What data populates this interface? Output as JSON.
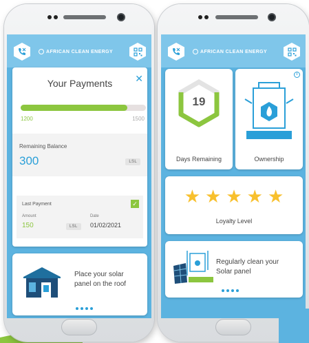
{
  "brand": "AFRICAN CLEAN ENERGY",
  "colors": {
    "primary_blue": "#2a9fd8",
    "light_blue": "#7fc6ea",
    "green": "#8cc63f",
    "star_yellow": "#f8c02d"
  },
  "left_screen": {
    "title": "Your Payments",
    "progress": {
      "min_label": "1200",
      "max_label": "1500",
      "fraction": 0.85
    },
    "remaining_balance": {
      "label": "Remaining Balance",
      "value": "300",
      "currency": "LSL"
    },
    "last_payment": {
      "label": "Last Payment",
      "amount_label": "Amount",
      "amount": "150",
      "currency": "LSL",
      "date_label": "Date",
      "date": "01/02/2021"
    },
    "tip": {
      "line1": "Place your solar",
      "line2": "panel on the roof"
    }
  },
  "right_screen": {
    "days": {
      "value": "19",
      "label": "Days Remaining",
      "fraction": 0.75
    },
    "ownership": {
      "label": "Ownership"
    },
    "loyalty": {
      "label": "Loyalty Level",
      "stars": 5,
      "max_stars": 5
    },
    "tip": {
      "line1": "Regularly clean your",
      "line2": "Solar panel"
    }
  }
}
